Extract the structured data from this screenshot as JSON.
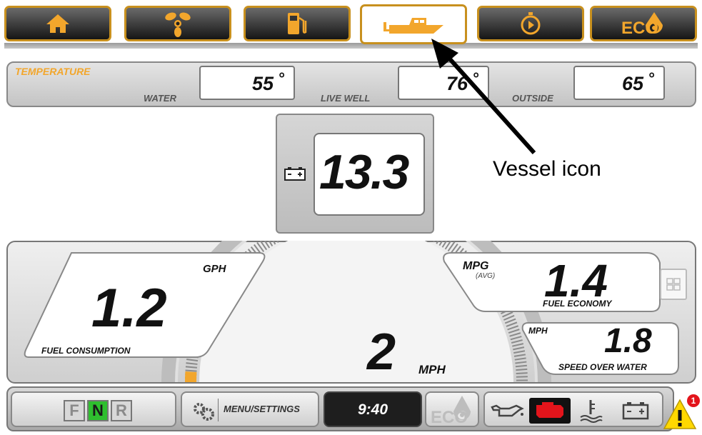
{
  "tabs": [
    {
      "icon": "home-icon",
      "active": false
    },
    {
      "icon": "propeller-icon",
      "active": false
    },
    {
      "icon": "fuel-pump-icon",
      "active": false
    },
    {
      "icon": "boat-icon",
      "active": true
    },
    {
      "icon": "trip-timer-icon",
      "active": false
    },
    {
      "icon": "eco-icon",
      "active": false,
      "label": "ECO"
    }
  ],
  "temperature": {
    "title": "TEMPERATURE",
    "water": {
      "label": "WATER",
      "value": "55",
      "unit": "°"
    },
    "live_well": {
      "label": "LIVE WELL",
      "value": "76",
      "unit": "°"
    },
    "outside": {
      "label": "OUTSIDE",
      "value": "65",
      "unit": "°"
    }
  },
  "battery": {
    "icon": "battery-icon",
    "value": "13.3"
  },
  "annotation": {
    "text": "Vessel icon"
  },
  "gauges": {
    "fuel_consumption": {
      "unit": "GPH",
      "value": "1.2",
      "label": "FUEL CONSUMPTION"
    },
    "fuel_economy": {
      "unit": "MPG",
      "sub": "(AVG)",
      "value": "1.4",
      "label": "FUEL ECONOMY"
    },
    "speed_over_water": {
      "unit": "MPH",
      "value": "1.8",
      "label": "SPEED OVER WATER"
    },
    "speed": {
      "value": "2",
      "unit": "MPH"
    },
    "speed_arc_fill": 0.02
  },
  "bottom_bar": {
    "gear": [
      "F",
      "N",
      "R"
    ],
    "gear_selected": "N",
    "menu_label": "MENU/SETTINGS",
    "clock": "9:40",
    "eco_label": "ECO",
    "alert_count": "1"
  },
  "colors": {
    "accent": "#f2a62c",
    "tab_border": "#c8901e",
    "gear_active": "#2fbf2f",
    "warning_red": "#e3141b",
    "warning_yellow": "#ffd800"
  }
}
